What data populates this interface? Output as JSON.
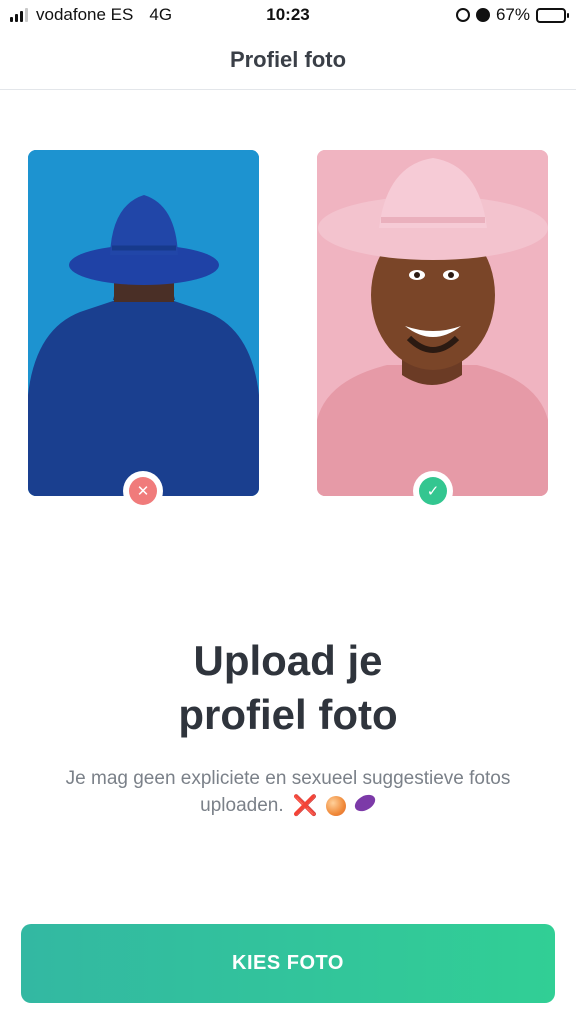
{
  "status_bar": {
    "carrier": "vodafone ES",
    "network": "4G",
    "time": "10:23",
    "battery": "67%",
    "battery_level": 0.67,
    "icons": [
      "signal-icon",
      "orientation-lock-icon",
      "alarm-icon",
      "battery-charging-icon"
    ]
  },
  "header": {
    "title": "Profiel foto"
  },
  "examples": {
    "bad": {
      "badge": "✕",
      "colors": {
        "background": "#1d93d0",
        "badge": "#f07b7b"
      }
    },
    "good": {
      "badge": "✓",
      "colors": {
        "background": "#f0b4c1",
        "badge": "#33c690"
      }
    }
  },
  "main": {
    "headline_line1": "Upload je",
    "headline_line2": "profiel foto",
    "subtext": "Je mag geen expliciete en sexueel suggestieve fotos uploaden.",
    "emojis": [
      "❌",
      "🍑",
      "🍆"
    ]
  },
  "button": {
    "label": "KIES FOTO",
    "colors": {
      "start": "#33b8a2",
      "end": "#31cf95"
    }
  }
}
